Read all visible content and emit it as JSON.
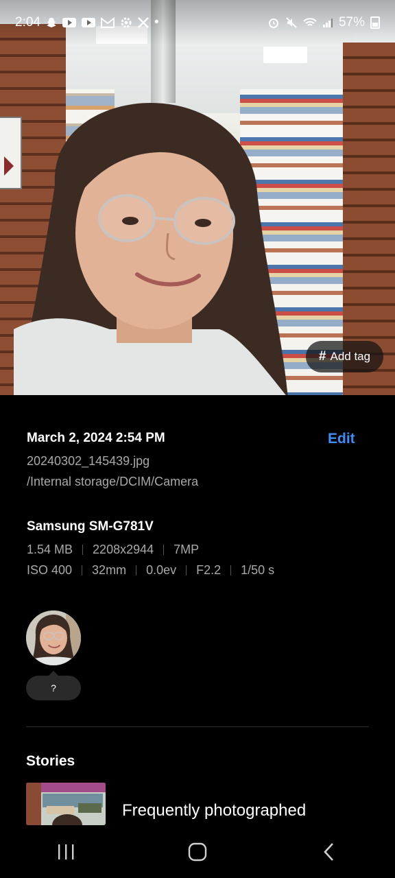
{
  "status_bar": {
    "time": "2:04",
    "battery": "57%",
    "dot": "•"
  },
  "photo": {
    "add_tag_label": "Add tag",
    "add_tag_icon": "hash-icon"
  },
  "details": {
    "date": "March 2, 2024 2:54 PM",
    "edit_label": "Edit",
    "filename": "20240302_145439.jpg",
    "path": "/Internal storage/DCIM/Camera",
    "device": "Samsung SM-G781V",
    "file_info": [
      "1.54 MB",
      "2208x2944",
      "7MP"
    ],
    "camera_info": [
      "ISO 400",
      "32mm",
      "0.0ev",
      "F2.2",
      "1/50 s"
    ]
  },
  "people": {
    "unknown_label": "?"
  },
  "stories": {
    "title": "Stories",
    "item_label": "Frequently photographed"
  },
  "colors": {
    "accent": "#3e8ef7",
    "background": "#000000",
    "secondary_text": "#a9a9a9"
  }
}
